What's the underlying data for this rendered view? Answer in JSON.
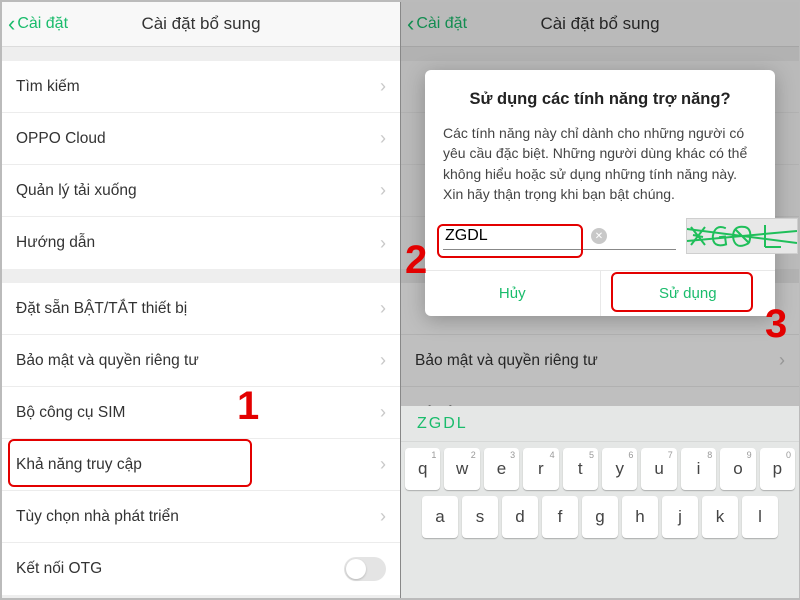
{
  "nav": {
    "back": "Cài đặt",
    "title": "Cài đặt bổ sung"
  },
  "groups": [
    {
      "items": [
        {
          "label": "Tìm kiếm"
        },
        {
          "label": "OPPO Cloud"
        },
        {
          "label": "Quản lý tải xuống"
        },
        {
          "label": "Hướng dẫn"
        }
      ]
    },
    {
      "items": [
        {
          "label": "Đặt sẵn BẬT/TẮT thiết bị"
        },
        {
          "label": "Bảo mật và quyền riêng tư"
        },
        {
          "label": "Bộ công cụ SIM"
        },
        {
          "label": "Khả năng truy cập"
        },
        {
          "label": "Tùy chọn nhà phát triển"
        },
        {
          "label": "Kết nối OTG",
          "toggle": true
        }
      ]
    }
  ],
  "dialog": {
    "title": "Sử dụng các tính năng trợ năng?",
    "body": "Các tính năng này chỉ dành cho những người có yêu cầu đặc biệt. Những người dùng khác có thể không hiểu hoặc sử dụng những tính năng này. Xin hãy thận trọng khi bạn bật chúng.",
    "input": "ZGDL",
    "cancel": "Hủy",
    "confirm": "Sử dụng"
  },
  "rightRows": {
    "privacy": "Bảo mật và quyền riêng tư",
    "sim": "Bộ công cụ SIM"
  },
  "keyboard": {
    "suggestion": "ZGDL",
    "row1": [
      "q",
      "w",
      "e",
      "r",
      "t",
      "y",
      "u",
      "i",
      "o",
      "p"
    ],
    "row1sup": [
      "1",
      "2",
      "3",
      "4",
      "5",
      "6",
      "7",
      "8",
      "9",
      "0"
    ],
    "row2": [
      "a",
      "s",
      "d",
      "f",
      "g",
      "h",
      "j",
      "k",
      "l"
    ]
  },
  "annotations": {
    "n1": "1",
    "n2": "2",
    "n3": "3"
  }
}
